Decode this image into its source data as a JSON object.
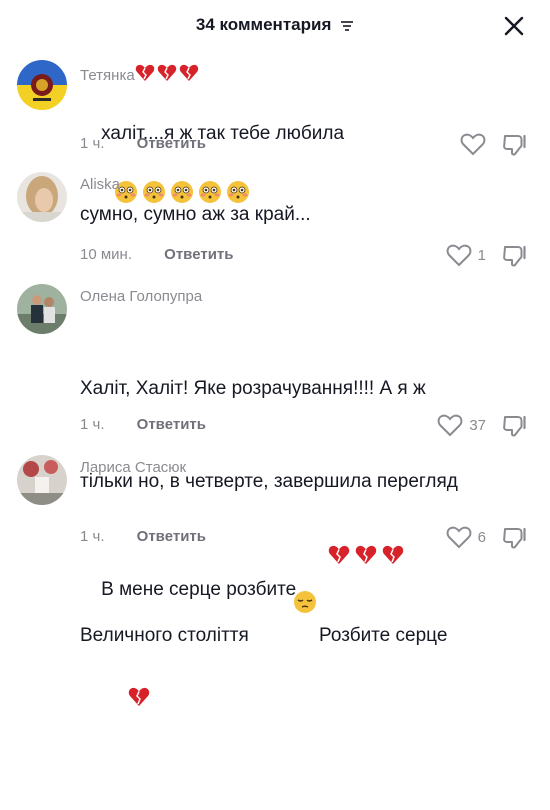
{
  "header": {
    "title": "34 комментария",
    "filter_icon": "filter-lines-icon",
    "close_icon": "close-icon"
  },
  "comments": [
    {
      "author": "Тетянка",
      "author_suffix": "💔💔💔",
      "text": "халіт....я ж так тебе любила",
      "text_suffix": "😳😳😳😳😳",
      "time": "1 ч.",
      "reply": "Ответить",
      "likes": ""
    },
    {
      "author": "Aliska",
      "text": "сумно, сумно аж за край...",
      "time": "10 мин.",
      "reply": "Ответить",
      "likes": "1"
    },
    {
      "author": "Олена Голопупра",
      "text_line1": "Халіт, Халіт! Яке розрачування!!!! А я ж",
      "text_line2": "тільки но, в четверте, завершила перегляд",
      "text_line3_a": "Величного століття",
      "text_line3_emoji": "😔",
      "text_line3_b": "Розбите серце",
      "text_line3_suffix": "💔",
      "time": "1 ч.",
      "reply": "Ответить",
      "likes": "37"
    },
    {
      "author": "Лариса Стасюк",
      "text": "В мене серце розбите",
      "text_suffix": "💔💔💔",
      "time": "1 ч.",
      "reply": "Ответить",
      "likes": "6"
    }
  ],
  "colors": {
    "primary_text": "#161823",
    "secondary_text": "#8a8b91",
    "heart_red": "#d8222a",
    "blush_yellow": "#f5c33b"
  }
}
